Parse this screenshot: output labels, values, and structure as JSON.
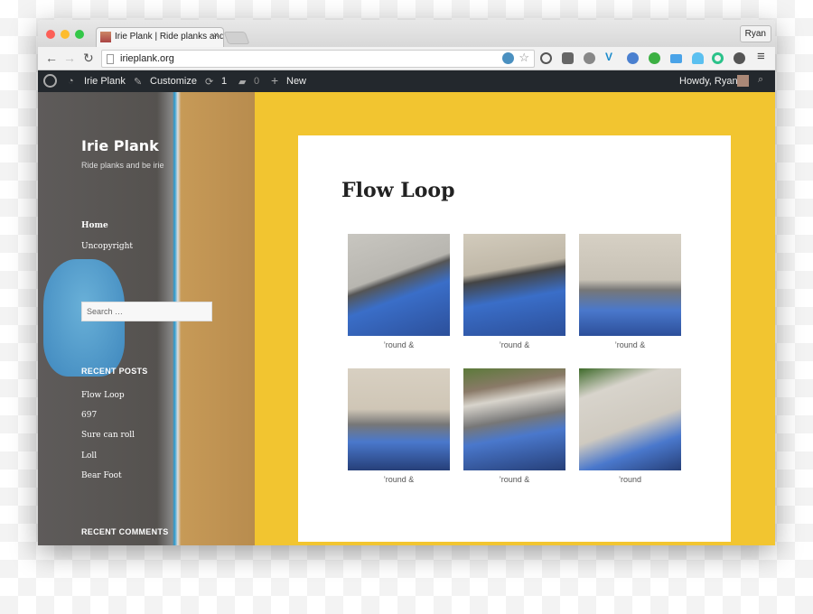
{
  "browser": {
    "tab_title": "Irie Plank | Ride planks and",
    "url": "irieplank.org",
    "profile": "Ryan",
    "extensions": [
      "wordpress-icon",
      "star-icon",
      "1password-icon",
      "pocket-icon",
      "wordpress-icon",
      "vimeo-icon",
      "globe-icon",
      "hangouts-icon",
      "cast-icon",
      "ghostery-icon",
      "grammarly-icon",
      "evernote-icon",
      "menu-icon"
    ]
  },
  "admin_bar": {
    "site": "Irie Plank",
    "customize": "Customize",
    "updates": "1",
    "comments": "0",
    "new": "New",
    "howdy": "Howdy, Ryan"
  },
  "sidebar": {
    "site_title": "Irie Plank",
    "tagline": "Ride planks and be irie",
    "menu": [
      "Home",
      "Uncopyright"
    ],
    "search_placeholder": "Search …",
    "recent_posts_heading": "RECENT POSTS",
    "recent_posts": [
      "Flow Loop",
      "697",
      "Sure can roll",
      "Loll",
      "Bear Foot"
    ],
    "recent_comments_heading": "RECENT COMMENTS"
  },
  "post": {
    "title": "Flow Loop",
    "gallery": [
      {
        "caption": "’round &"
      },
      {
        "caption": "’round &"
      },
      {
        "caption": "’round &"
      },
      {
        "caption": "’round &"
      },
      {
        "caption": "’round &"
      },
      {
        "caption": "’round"
      }
    ]
  },
  "colors": {
    "accent": "#f2c530",
    "admin_bar": "#23282d"
  }
}
